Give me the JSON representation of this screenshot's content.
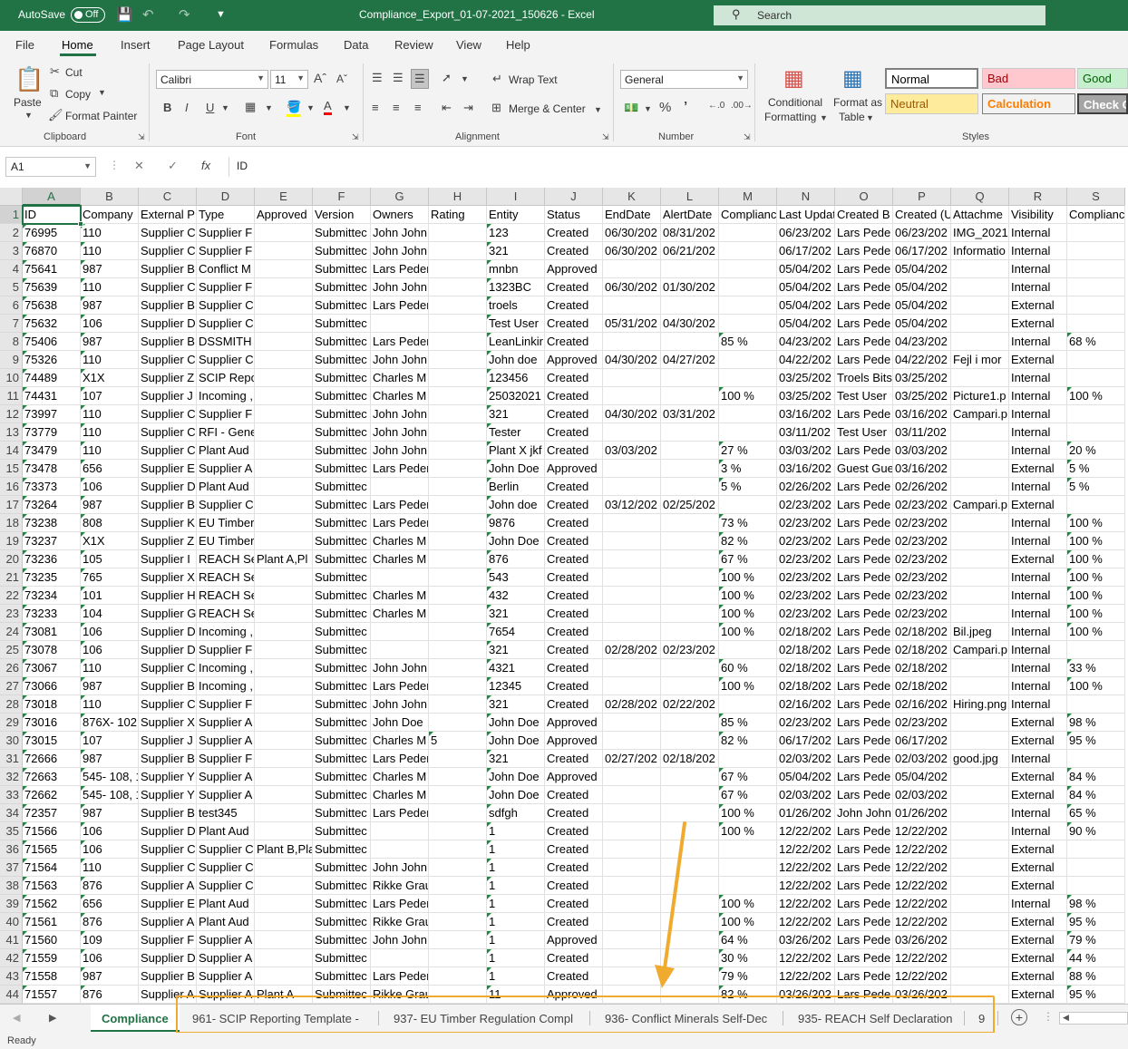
{
  "titlebar": {
    "autosave_label": "AutoSave",
    "autosave_state": "Off",
    "document_title": "Compliance_Export_01-07-2021_150626  -  Excel",
    "search_label": "Search"
  },
  "menu": {
    "tabs": [
      "File",
      "Home",
      "Insert",
      "Page Layout",
      "Formulas",
      "Data",
      "Review",
      "View",
      "Help"
    ],
    "active": "Home"
  },
  "ribbon": {
    "clipboard": {
      "paste": "Paste",
      "cut": "Cut",
      "copy": "Copy",
      "format_painter": "Format Painter",
      "label": "Clipboard"
    },
    "font": {
      "family": "Calibri",
      "size": "11",
      "label": "Font"
    },
    "alignment": {
      "wrap_text": "Wrap Text",
      "merge_center": "Merge & Center",
      "label": "Alignment"
    },
    "number": {
      "format": "General",
      "label": "Number"
    },
    "styles": {
      "conditional_formatting": [
        "Conditional",
        "Formatting"
      ],
      "format_as_table": [
        "Format as",
        "Table"
      ],
      "normal": "Normal",
      "bad": "Bad",
      "good": "Good",
      "neutral": "Neutral",
      "calculation": "Calculation",
      "check_cell": "Check Ce",
      "label": "Styles"
    },
    "colors": {
      "bad_bg": "#ffc7ce",
      "bad_fg": "#9c0006",
      "good_bg": "#c6efce",
      "good_fg": "#006100",
      "neutral_bg": "#ffeb9c",
      "neutral_fg": "#9c5700",
      "calc_bg": "#f2f2f2",
      "calc_fg": "#fa7d00",
      "check_bg": "#a5a5a5"
    }
  },
  "formula_bar": {
    "name_box": "A1",
    "value": "ID"
  },
  "columns": [
    "A",
    "B",
    "C",
    "D",
    "E",
    "F",
    "G",
    "H",
    "I",
    "J",
    "K",
    "L",
    "M",
    "N",
    "O",
    "P",
    "Q",
    "R",
    "S"
  ],
  "rows": [
    [
      "ID",
      "Company",
      "External P",
      "Type",
      "Approved",
      "Version",
      "Owners",
      "Rating",
      "Entity",
      "Status",
      "EndDate",
      "AlertDate",
      "Complianc",
      "Last Updat",
      "Created B",
      "Created (U",
      "Attachme",
      "Visibility",
      "Complianc"
    ],
    [
      "76995",
      "110",
      "Supplier C",
      "Supplier F",
      "",
      "Submittec",
      "John John",
      "",
      "123",
      "Created",
      "06/30/202",
      "08/31/202",
      "",
      "06/23/202",
      "Lars Pede",
      "06/23/202",
      "IMG_2021",
      "Internal",
      ""
    ],
    [
      "76870",
      "110",
      "Supplier C",
      "Supplier F",
      "",
      "Submittec",
      "John John",
      "",
      "321",
      "Created",
      "06/30/202",
      "06/21/202",
      "",
      "06/17/202",
      "Lars Pede",
      "06/17/202",
      "Informatio",
      "Internal",
      ""
    ],
    [
      "75641",
      "987",
      "Supplier B",
      "Conflict M",
      "",
      "Submittec",
      "Lars Peder",
      "",
      "mnbn",
      "Approved",
      "",
      "",
      "",
      "05/04/202",
      "Lars Pede",
      "05/04/202",
      "",
      "Internal",
      ""
    ],
    [
      "75639",
      "110",
      "Supplier C",
      "Supplier F",
      "",
      "Submittec",
      "John John",
      "",
      "1323BC",
      "Created",
      "06/30/202",
      "01/30/202",
      "",
      "05/04/202",
      "Lars Pede",
      "05/04/202",
      "",
      "Internal",
      ""
    ],
    [
      "75638",
      "987",
      "Supplier B",
      "Supplier C",
      "",
      "Submittec",
      "Lars Peder",
      "",
      "troels",
      "Created",
      "",
      "",
      "",
      "05/04/202",
      "Lars Pede",
      "05/04/202",
      "",
      "External",
      ""
    ],
    [
      "75632",
      "106",
      "Supplier D",
      "Supplier C",
      "",
      "Submittec",
      "",
      "",
      "Test User",
      "Created",
      "05/31/202",
      "04/30/202",
      "",
      "05/04/202",
      "Lars Pede",
      "05/04/202",
      "",
      "External",
      ""
    ],
    [
      "75406",
      "987",
      "Supplier B",
      "DSSMITH (",
      "",
      "Submittec",
      "Lars Peder",
      "",
      "LeanLinkir",
      "Created",
      "",
      "",
      "85 %",
      "04/23/202",
      "Lars Pede",
      "04/23/202",
      "",
      "Internal",
      "68 %"
    ],
    [
      "75326",
      "110",
      "Supplier C",
      "Supplier C",
      "",
      "Submittec",
      "John John",
      "",
      "John doe",
      "Approved",
      "04/30/202",
      "04/27/202",
      "",
      "04/22/202",
      "Lars Pede",
      "04/22/202",
      "Fejl i mor",
      "External",
      ""
    ],
    [
      "74489",
      "X1X",
      "Supplier Z",
      "SCIP Repo",
      "",
      "Submittec",
      "Charles M",
      "",
      "123456",
      "Created",
      "",
      "",
      "",
      "03/25/202",
      "Troels Bits",
      "03/25/202",
      "",
      "Internal",
      ""
    ],
    [
      "74431",
      "107",
      "Supplier J",
      "Incoming ,",
      "",
      "Submittec",
      "Charles M",
      "",
      "25032021",
      "Created",
      "",
      "",
      "100 %",
      "03/25/202",
      "Test User",
      "03/25/202",
      "Picture1.p",
      "Internal",
      "100 %"
    ],
    [
      "73997",
      "110",
      "Supplier C",
      "Supplier F",
      "",
      "Submittec",
      "John John",
      "",
      "321",
      "Created",
      "04/30/202",
      "03/31/202",
      "",
      "03/16/202",
      "Lars Pede",
      "03/16/202",
      "Campari.p",
      "Internal",
      ""
    ],
    [
      "73779",
      "110",
      "Supplier C",
      "RFI - Gene",
      "",
      "Submittec",
      "John John",
      "",
      "Tester",
      "Created",
      "",
      "",
      "",
      "03/11/202",
      "Test User",
      "03/11/202",
      "",
      "Internal",
      ""
    ],
    [
      "73479",
      "110",
      "Supplier C",
      "Plant Aud",
      "",
      "Submittec",
      "John John",
      "",
      "Plant X jkf",
      "Created",
      "03/03/202",
      "",
      "27 %",
      "03/03/202",
      "Lars Pede",
      "03/03/202",
      "",
      "Internal",
      "20 %"
    ],
    [
      "73478",
      "656",
      "Supplier E",
      "Supplier A",
      "",
      "Submittec",
      "Lars Peder",
      "",
      "John Doe",
      "Approved",
      "",
      "",
      "3 %",
      "03/16/202",
      "Guest Gue",
      "03/16/202",
      "",
      "External",
      "5 %"
    ],
    [
      "73373",
      "106",
      "Supplier D",
      "Plant Aud",
      "",
      "Submittec",
      "",
      "",
      "Berlin",
      "Created",
      "",
      "",
      "5 %",
      "02/26/202",
      "Lars Pede",
      "02/26/202",
      "",
      "Internal",
      "5 %"
    ],
    [
      "73264",
      "987",
      "Supplier B",
      "Supplier C",
      "",
      "Submittec",
      "Lars Peder",
      "",
      "John doe",
      "Created",
      "03/12/202",
      "02/25/202",
      "",
      "02/23/202",
      "Lars Pede",
      "02/23/202",
      "Campari.p",
      "External",
      ""
    ],
    [
      "73238",
      "808",
      "Supplier K",
      "EU Timber",
      "",
      "Submittec",
      "Lars Peder",
      "",
      "9876",
      "Created",
      "",
      "",
      "73 %",
      "02/23/202",
      "Lars Pede",
      "02/23/202",
      "",
      "Internal",
      "100 %"
    ],
    [
      "73237",
      "X1X",
      "Supplier Z",
      "EU Timber",
      "",
      "Submittec",
      "Charles M",
      "",
      "John Doe",
      "Created",
      "",
      "",
      "82 %",
      "02/23/202",
      "Lars Pede",
      "02/23/202",
      "",
      "Internal",
      "100 %"
    ],
    [
      "73236",
      "105",
      "Supplier I",
      "REACH Sel",
      "Plant A,Pl",
      "Submittec",
      "Charles M",
      "",
      "876",
      "Created",
      "",
      "",
      "67 %",
      "02/23/202",
      "Lars Pede",
      "02/23/202",
      "",
      "External",
      "100 %"
    ],
    [
      "73235",
      "765",
      "Supplier X",
      "REACH Sel",
      "",
      "Submittec",
      "",
      "",
      "543",
      "Created",
      "",
      "",
      "100 %",
      "02/23/202",
      "Lars Pede",
      "02/23/202",
      "",
      "Internal",
      "100 %"
    ],
    [
      "73234",
      "101",
      "Supplier H",
      "REACH Sel",
      "",
      "Submittec",
      "Charles M",
      "",
      "432",
      "Created",
      "",
      "",
      "100 %",
      "02/23/202",
      "Lars Pede",
      "02/23/202",
      "",
      "Internal",
      "100 %"
    ],
    [
      "73233",
      "104",
      "Supplier G",
      "REACH Sel",
      "",
      "Submittec",
      "Charles M",
      "",
      "321",
      "Created",
      "",
      "",
      "100 %",
      "02/23/202",
      "Lars Pede",
      "02/23/202",
      "",
      "Internal",
      "100 %"
    ],
    [
      "73081",
      "106",
      "Supplier D",
      "Incoming ,",
      "",
      "Submittec",
      "",
      "",
      "7654",
      "Created",
      "",
      "",
      "100 %",
      "02/18/202",
      "Lars Pede",
      "02/18/202",
      "Bil.jpeg",
      "Internal",
      "100 %"
    ],
    [
      "73078",
      "106",
      "Supplier D",
      "Supplier F",
      "",
      "Submittec",
      "",
      "",
      "321",
      "Created",
      "02/28/202",
      "02/23/202",
      "",
      "02/18/202",
      "Lars Pede",
      "02/18/202",
      "Campari.p",
      "Internal",
      ""
    ],
    [
      "73067",
      "110",
      "Supplier C",
      "Incoming ,",
      "",
      "Submittec",
      "John John",
      "",
      "4321",
      "Created",
      "",
      "",
      "60 %",
      "02/18/202",
      "Lars Pede",
      "02/18/202",
      "",
      "Internal",
      "33 %"
    ],
    [
      "73066",
      "987",
      "Supplier B",
      "Incoming ,",
      "",
      "Submittec",
      "Lars Peder",
      "",
      "12345",
      "Created",
      "",
      "",
      "100 %",
      "02/18/202",
      "Lars Pede",
      "02/18/202",
      "",
      "Internal",
      "100 %"
    ],
    [
      "73018",
      "110",
      "Supplier C",
      "Supplier F",
      "",
      "Submittec",
      "John John",
      "",
      "321",
      "Created",
      "02/28/202",
      "02/22/202",
      "",
      "02/16/202",
      "Lars Pede",
      "02/16/202",
      "Hiring.png",
      "Internal",
      ""
    ],
    [
      "73016",
      "876X- 102,",
      "Supplier X",
      "Supplier A",
      "",
      "Submittec",
      "John  Doe",
      "",
      "John Doe",
      "Approved",
      "",
      "",
      "85 %",
      "02/23/202",
      "Lars Pede",
      "02/23/202",
      "",
      "External",
      "98 %"
    ],
    [
      "73015",
      "107",
      "Supplier J",
      "Supplier A",
      "",
      "Submittec",
      "Charles M",
      "5",
      "John Doe",
      "Approved",
      "",
      "",
      "82 %",
      "06/17/202",
      "Lars Pede",
      "06/17/202",
      "",
      "External",
      "95 %"
    ],
    [
      "72666",
      "987",
      "Supplier B",
      "Supplier F",
      "",
      "Submittec",
      "Lars Peder",
      "",
      "321",
      "Created",
      "02/27/202",
      "02/18/202",
      "",
      "02/03/202",
      "Lars Pede",
      "02/03/202",
      "good.jpg",
      "Internal",
      ""
    ],
    [
      "72663",
      "545- 108, 1",
      "Supplier Y",
      "Supplier A",
      "",
      "Submittec",
      "Charles M",
      "",
      "John Doe",
      "Approved",
      "",
      "",
      "67 %",
      "05/04/202",
      "Lars Pede",
      "05/04/202",
      "",
      "External",
      "84 %"
    ],
    [
      "72662",
      "545- 108, 1",
      "Supplier Y",
      "Supplier A",
      "",
      "Submittec",
      "Charles M",
      "",
      "John Doe",
      "Created",
      "",
      "",
      "67 %",
      "02/03/202",
      "Lars Pede",
      "02/03/202",
      "",
      "External",
      "84 %"
    ],
    [
      "72357",
      "987",
      "Supplier B",
      "test345",
      "",
      "Submittec",
      "Lars Peder",
      "",
      "sdfgh",
      "Created",
      "",
      "",
      "100 %",
      "01/26/202",
      "John John",
      "01/26/202",
      "",
      "Internal",
      "65 %"
    ],
    [
      "71566",
      "106",
      "Supplier D",
      "Plant Aud",
      "",
      "Submittec",
      "",
      "",
      "1",
      "Created",
      "",
      "",
      "100 %",
      "12/22/202",
      "Lars Pede",
      "12/22/202",
      "",
      "Internal",
      "90 %"
    ],
    [
      "71565",
      "106",
      "Supplier C",
      "Supplier C",
      "Plant B,Pla",
      "Submittec",
      "",
      "",
      "1",
      "Created",
      "",
      "",
      "",
      "12/22/202",
      "Lars Pede",
      "12/22/202",
      "",
      "External",
      ""
    ],
    [
      "71564",
      "110",
      "Supplier C",
      "Supplier C",
      "",
      "Submittec",
      "John John",
      "",
      "1",
      "Created",
      "",
      "",
      "",
      "12/22/202",
      "Lars Pede",
      "12/22/202",
      "",
      "External",
      ""
    ],
    [
      "71563",
      "876",
      "Supplier A",
      "Supplier C",
      "",
      "Submittec",
      "Rikke Grau",
      "",
      "1",
      "Created",
      "",
      "",
      "",
      "12/22/202",
      "Lars Pede",
      "12/22/202",
      "",
      "External",
      ""
    ],
    [
      "71562",
      "656",
      "Supplier E",
      "Plant Aud",
      "",
      "Submittec",
      "Lars Peder",
      "",
      "1",
      "Created",
      "",
      "",
      "100 %",
      "12/22/202",
      "Lars Pede",
      "12/22/202",
      "",
      "Internal",
      "98 %"
    ],
    [
      "71561",
      "876",
      "Supplier A",
      "Plant Aud",
      "",
      "Submittec",
      "Rikke Grau",
      "",
      "1",
      "Created",
      "",
      "",
      "100 %",
      "12/22/202",
      "Lars Pede",
      "12/22/202",
      "",
      "External",
      "95 %"
    ],
    [
      "71560",
      "109",
      "Supplier F",
      "Supplier A",
      "",
      "Submittec",
      "John John",
      "",
      "1",
      "Approved",
      "",
      "",
      "64 %",
      "03/26/202",
      "Lars Pede",
      "03/26/202",
      "",
      "External",
      "79 %"
    ],
    [
      "71559",
      "106",
      "Supplier D",
      "Supplier A",
      "",
      "Submittec",
      "",
      "",
      "1",
      "Created",
      "",
      "",
      "30 %",
      "12/22/202",
      "Lars Pede",
      "12/22/202",
      "",
      "External",
      "44 %"
    ],
    [
      "71558",
      "987",
      "Supplier B",
      "Supplier A",
      "",
      "Submittec",
      "Lars Peder",
      "",
      "1",
      "Created",
      "",
      "",
      "79 %",
      "12/22/202",
      "Lars Pede",
      "12/22/202",
      "",
      "External",
      "88 %"
    ],
    [
      "71557",
      "876",
      "Supplier A",
      "Supplier A",
      "Plant A",
      "Submittec",
      "Rikke Grau",
      "",
      "11",
      "Approved",
      "",
      "",
      "82 %",
      "03/26/202",
      "Lars Pede",
      "03/26/202",
      "",
      "External",
      "95 %"
    ]
  ],
  "sheet_tabs": {
    "active": "Compliance",
    "others": [
      "961- SCIP Reporting Template -",
      "937- EU Timber Regulation Compl",
      "936- Conflict Minerals Self-Dec",
      "935- REACH Self Declaration",
      "9"
    ]
  },
  "status": "Ready",
  "annotation_color": "#f0ab2e"
}
